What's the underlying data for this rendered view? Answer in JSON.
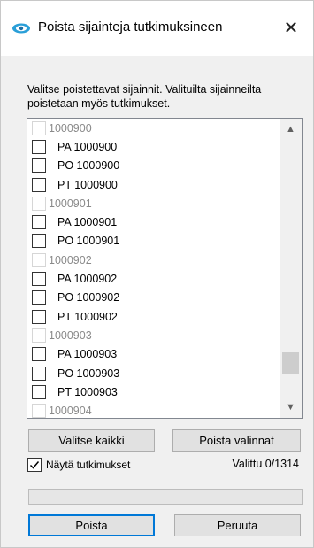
{
  "window": {
    "title": "Poista sijainteja tutkimuksineen",
    "close_label": "✕",
    "app_icon": "tracking-icon"
  },
  "instructions": "Valitse poistettavat sijainnit. Valituilta sijainneilta poistetaan myös tutkimukset.",
  "list": {
    "rows": [
      {
        "type": "header",
        "label": "1000900"
      },
      {
        "type": "item",
        "label": "PA 1000900"
      },
      {
        "type": "item",
        "label": "PO 1000900"
      },
      {
        "type": "item",
        "label": "PT 1000900"
      },
      {
        "type": "header",
        "label": "1000901"
      },
      {
        "type": "item",
        "label": "PA 1000901"
      },
      {
        "type": "item",
        "label": "PO 1000901"
      },
      {
        "type": "header",
        "label": "1000902"
      },
      {
        "type": "item",
        "label": "PA 1000902"
      },
      {
        "type": "item",
        "label": "PO 1000902"
      },
      {
        "type": "item",
        "label": "PT 1000902"
      },
      {
        "type": "header",
        "label": "1000903"
      },
      {
        "type": "item",
        "label": "PA 1000903"
      },
      {
        "type": "item",
        "label": "PO 1000903"
      },
      {
        "type": "item",
        "label": "PT 1000903"
      },
      {
        "type": "header",
        "label": "1000904"
      }
    ]
  },
  "buttons": {
    "select_all": "Valitse kaikki",
    "clear_selection": "Poista valinnat",
    "delete": "Poista",
    "cancel": "Peruuta"
  },
  "show_studies": {
    "label": "Näytä tutkimukset",
    "checked": true
  },
  "counter": "Valittu 0/1314",
  "progress": 0,
  "colors": {
    "accent": "#0078d7",
    "header_text": "#8a8a8a"
  }
}
